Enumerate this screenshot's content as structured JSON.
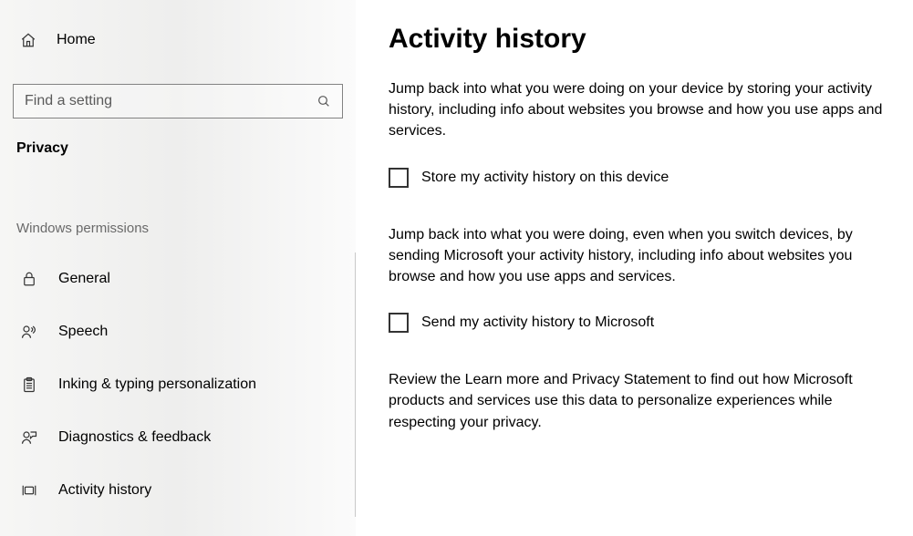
{
  "sidebar": {
    "home_label": "Home",
    "search_placeholder": "Find a setting",
    "category": "Privacy",
    "section_header": "Windows permissions",
    "items": [
      {
        "label": "General"
      },
      {
        "label": "Speech"
      },
      {
        "label": "Inking & typing personalization"
      },
      {
        "label": "Diagnostics & feedback"
      },
      {
        "label": "Activity history"
      }
    ]
  },
  "page": {
    "title": "Activity history",
    "paragraph1": "Jump back into what you were doing on your device by storing your activity history, including info about websites you browse and how you use apps and services.",
    "checkbox1_label": "Store my activity history on this device",
    "paragraph2": "Jump back into what you were doing, even when you switch devices, by sending Microsoft your activity history, including info about websites you browse and how you use apps and services.",
    "checkbox2_label": "Send my activity history to Microsoft",
    "paragraph3": "Review the Learn more and Privacy Statement to find out how Microsoft products and services use this data to personalize experiences while respecting your privacy."
  }
}
